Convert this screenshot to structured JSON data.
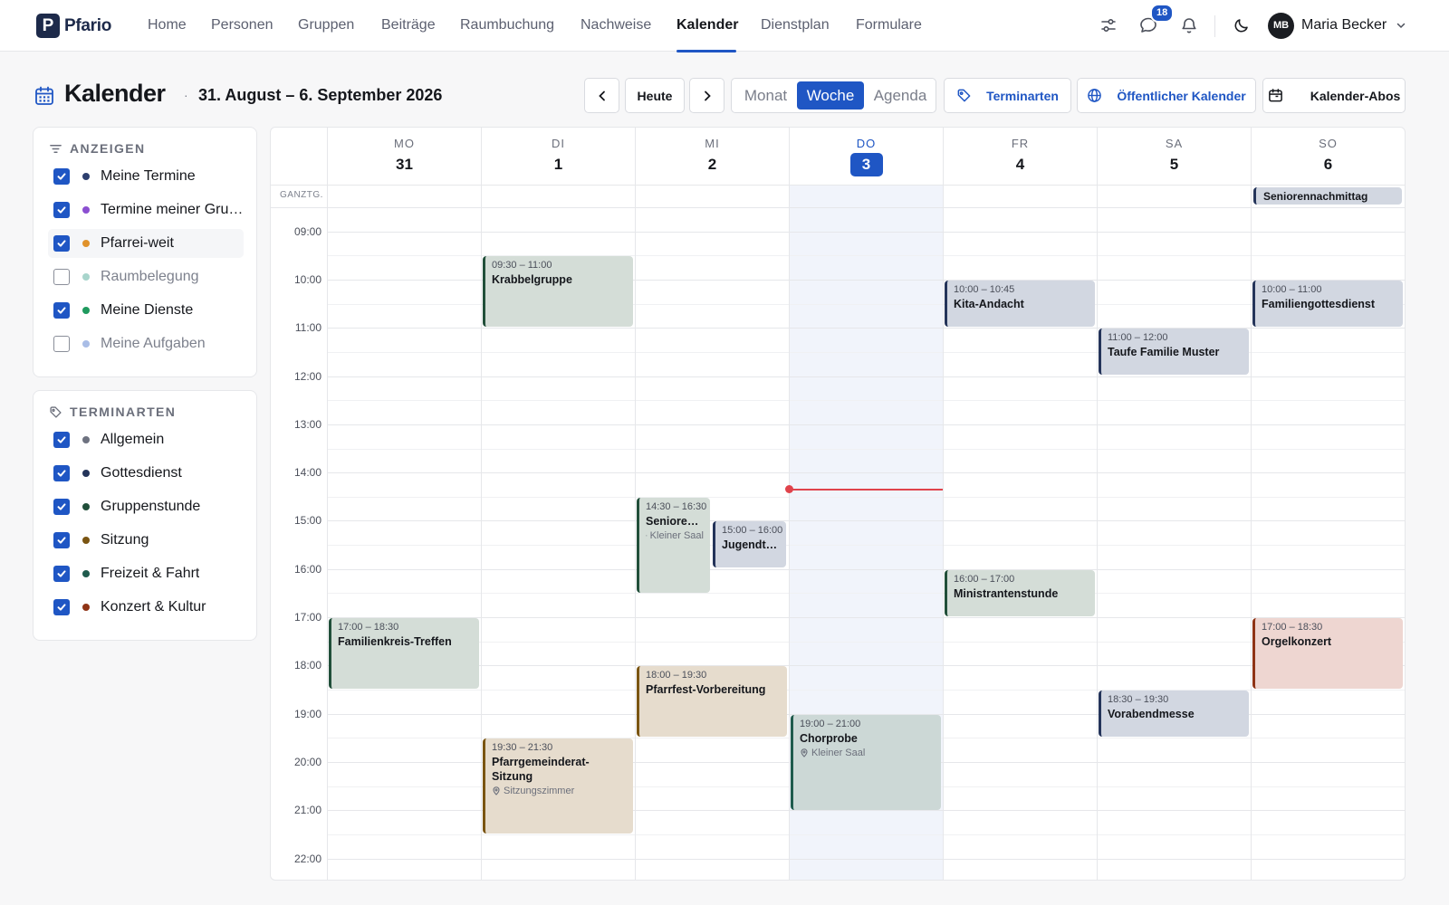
{
  "app": {
    "logo_letter": "P",
    "name": "Pfario"
  },
  "nav": {
    "items": [
      "Home",
      "Personen",
      "Gruppen",
      "Beiträge",
      "Raumbuchung",
      "Nachweise",
      "Kalender",
      "Dienstplan",
      "Formulare"
    ],
    "active": "Kalender",
    "message_badge": "18",
    "user": {
      "initials": "MB",
      "name": "Maria Becker"
    }
  },
  "header": {
    "title": "Kalender",
    "separator": "·",
    "date_range": "31. August – 6. September 2026",
    "today_button": "Heute",
    "views": [
      "Monat",
      "Woche",
      "Agenda"
    ],
    "active_view": "Woche",
    "event_types_button": "Terminarten",
    "public_calendar_button": "Öffentlicher Kalender",
    "subscriptions_button": "Kalender-Abos"
  },
  "sidebar": {
    "show": {
      "heading": "ANZEIGEN",
      "items": [
        {
          "label": "Meine Termine",
          "checked": true,
          "color": "#2d3f6e"
        },
        {
          "label": "Termine meiner Gruppen",
          "checked": true,
          "color": "#8b4fd1"
        },
        {
          "label": "Pfarrei-weit",
          "checked": true,
          "color": "#e0922b"
        },
        {
          "label": "Raumbelegung",
          "checked": false,
          "color": "#a8d5cc"
        },
        {
          "label": "Meine Dienste",
          "checked": true,
          "color": "#1f9a5e"
        },
        {
          "label": "Meine Aufgaben",
          "checked": false,
          "color": "#a9bde6"
        }
      ]
    },
    "types": {
      "heading": "TERMINARTEN",
      "items": [
        {
          "label": "Allgemein",
          "checked": true,
          "color": "#6e7280"
        },
        {
          "label": "Gottesdienst",
          "checked": true,
          "color": "#24345a"
        },
        {
          "label": "Gruppenstunde",
          "checked": true,
          "color": "#214f3a"
        },
        {
          "label": "Sitzung",
          "checked": true,
          "color": "#7a5512"
        },
        {
          "label": "Freizeit & Fahrt",
          "checked": true,
          "color": "#1f5b4d"
        },
        {
          "label": "Konzert & Kultur",
          "checked": true,
          "color": "#8f3416"
        }
      ]
    }
  },
  "calendar": {
    "allday_label": "GANZTG.",
    "days": [
      {
        "name": "MO",
        "num": "31"
      },
      {
        "name": "DI",
        "num": "1"
      },
      {
        "name": "MI",
        "num": "2"
      },
      {
        "name": "DO",
        "num": "3",
        "today": true
      },
      {
        "name": "FR",
        "num": "4"
      },
      {
        "name": "SA",
        "num": "5"
      },
      {
        "name": "SO",
        "num": "6"
      }
    ],
    "hours": [
      "09:00",
      "10:00",
      "11:00",
      "12:00",
      "13:00",
      "14:00",
      "15:00",
      "16:00",
      "17:00",
      "18:00",
      "19:00",
      "20:00",
      "21:00",
      "22:00"
    ],
    "now": "14:20",
    "allday_events": [
      {
        "day": 6,
        "title": "Seniorennachmittag",
        "type": "navy"
      }
    ],
    "events": [
      {
        "day": 1,
        "start": "09:30",
        "end": "11:00",
        "time": "09:30 – 11:00",
        "title": "Krabbelgruppe",
        "type": "green"
      },
      {
        "day": 4,
        "start": "10:00",
        "end": "11:00",
        "time": "10:00 – 10:45",
        "title": "Kita-Andacht",
        "type": "navy"
      },
      {
        "day": 6,
        "start": "10:00",
        "end": "11:00",
        "time": "10:00 – 11:00",
        "title": "Familiengottesdienst",
        "type": "navy"
      },
      {
        "day": 5,
        "start": "11:00",
        "end": "12:00",
        "time": "11:00 – 12:00",
        "title": "Taufe Familie Muster",
        "type": "navy"
      },
      {
        "day": 2,
        "start": "14:30",
        "end": "16:30",
        "time": "14:30 – 16:30",
        "title": "Seniorencafé",
        "location": "Kleiner Saal",
        "type": "green",
        "col": 0
      },
      {
        "day": 2,
        "start": "15:00",
        "end": "16:00",
        "time": "15:00 – 16:00",
        "title": "Jugendtreff",
        "type": "navy",
        "col": 1
      },
      {
        "day": 4,
        "start": "16:00",
        "end": "17:00",
        "time": "16:00 – 17:00",
        "title": "Ministrantenstunde",
        "type": "green"
      },
      {
        "day": 0,
        "start": "17:00",
        "end": "18:30",
        "time": "17:00 – 18:30",
        "title": "Familienkreis-Treffen",
        "type": "green"
      },
      {
        "day": 6,
        "start": "17:00",
        "end": "18:30",
        "time": "17:00 – 18:30",
        "title": "Orgelkonzert",
        "type": "red"
      },
      {
        "day": 2,
        "start": "18:00",
        "end": "19:30",
        "time": "18:00 – 19:30",
        "title": "Pfarrfest-Vorbereitung",
        "type": "olive"
      },
      {
        "day": 5,
        "start": "18:30",
        "end": "19:30",
        "time": "18:30 – 19:30",
        "title": "Vorabendmesse",
        "type": "navy"
      },
      {
        "day": 3,
        "start": "19:00",
        "end": "21:00",
        "time": "19:00 – 21:00",
        "title": "Chorprobe",
        "location": "Kleiner Saal",
        "type": "teal"
      },
      {
        "day": 1,
        "start": "19:30",
        "end": "21:30",
        "time": "19:30 – 21:30",
        "title": "Pfarrgemeinderat-Sitzung",
        "location": "Sitzungszimmer",
        "type": "olive"
      }
    ]
  }
}
